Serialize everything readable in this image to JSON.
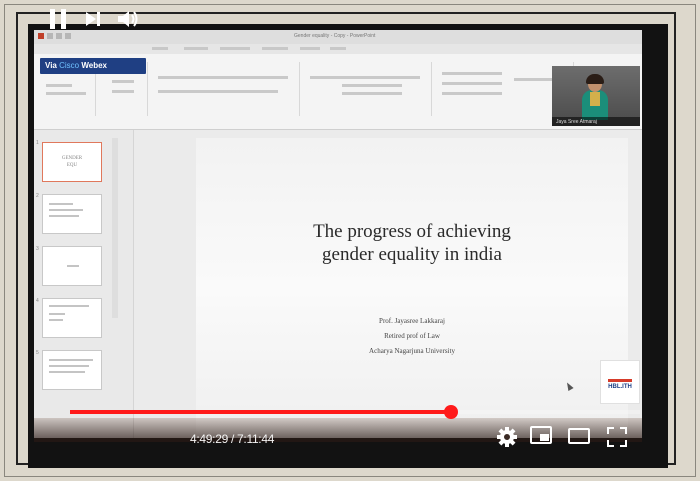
{
  "powerpoint": {
    "window_title": "Gender equality - Copy - PowerPoint",
    "webex_badge": {
      "prefix": "Via ",
      "brand": "Cisco",
      "suffix": " Webex"
    }
  },
  "slide": {
    "title_line1": "The progress of achieving",
    "title_line2": "gender equality in india",
    "author_name": "Prof. Jayasree Lakkaraj",
    "author_role": "Retired prof of Law",
    "author_affiliation": "Acharya Nagarjuna University"
  },
  "thumbnails": {
    "slide1_text_line1": "GENDER",
    "slide1_text_line2": "EQU",
    "numbers": [
      "1",
      "2",
      "3",
      "4",
      "5"
    ]
  },
  "webcam": {
    "participant_name": "Jaya Sree Atmaraj"
  },
  "logo_stamp": {
    "text": "HBL.ITH"
  },
  "player": {
    "current_time": "4:49:29",
    "duration": "7:11:44",
    "time_separator": " / ",
    "progress_fraction": 0.6691
  },
  "colors": {
    "progress": "#ff1a1a",
    "webex_badge_bg": "#1f3f83",
    "thumb_selected": "#e0785c"
  },
  "icons": [
    "play-pause-icon",
    "next-icon",
    "volume-icon",
    "settings-gear-icon",
    "miniplayer-icon",
    "theater-mode-icon",
    "fullscreen-icon"
  ]
}
